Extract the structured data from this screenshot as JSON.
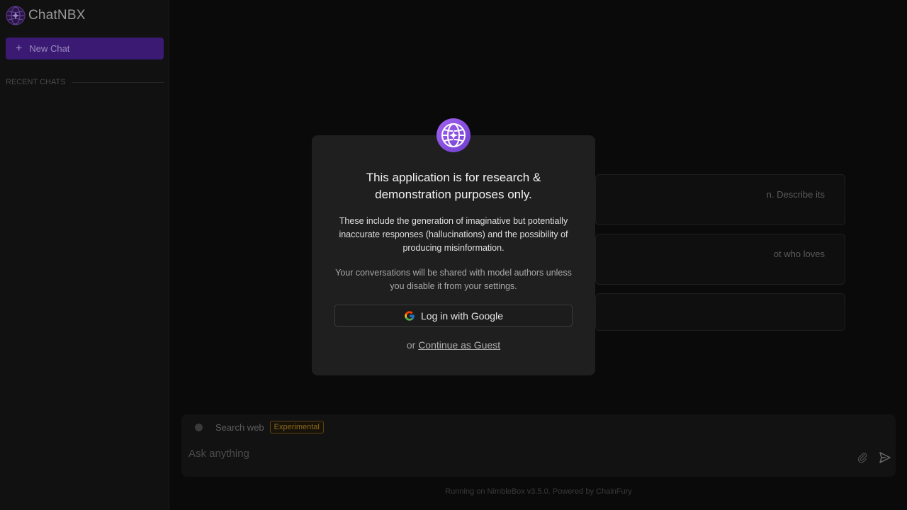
{
  "sidebar": {
    "brand": "ChatNBX",
    "new_chat": "New Chat",
    "recent_heading": "RECENT CHATS"
  },
  "suggestions": [
    {
      "text": "n. Describe its"
    },
    {
      "text": "ot who loves"
    },
    {
      "text": ""
    }
  ],
  "composer": {
    "search_label": "Search web",
    "badge": "Experimental",
    "placeholder": "Ask anything",
    "search_web_enabled": false
  },
  "footer": "Running on NimbleBox v3.5.0. Powered by ChainFury",
  "modal": {
    "title": "This application is for research & demonstration purposes only.",
    "body": "These include the generation of imaginative but potentially inaccurate responses (hallucinations) and the possibility of producing misinformation.",
    "note": "Your conversations will be shared with model authors unless you disable it from your settings.",
    "google_button": "Log in with Google",
    "or": "or",
    "guest_link": "Continue as Guest"
  },
  "colors": {
    "accent": "#3b1a73",
    "logo": "#8b4fe0",
    "badge": "#8c6a1a"
  },
  "icons": {
    "brand": "globe-sparkle-icon",
    "plus": "plus-icon",
    "google": "google-icon",
    "attach": "paperclip-icon",
    "send": "send-icon"
  }
}
